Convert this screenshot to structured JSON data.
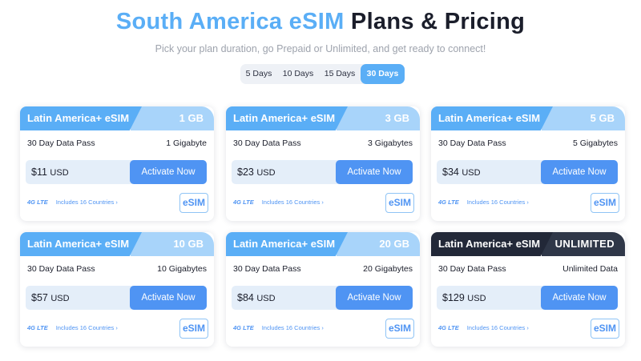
{
  "header": {
    "title_accent": "South America eSIM",
    "title_rest": "Plans & Pricing",
    "subtitle": "Pick your plan duration, go Prepaid or Unlimited, and get ready to connect!"
  },
  "duration_tabs": [
    {
      "label": "5 Days",
      "active": false
    },
    {
      "label": "10 Days",
      "active": false
    },
    {
      "label": "15 Days",
      "active": false
    },
    {
      "label": "30 Days",
      "active": true
    }
  ],
  "plans": [
    {
      "name": "Latin America+ eSIM",
      "size": "1 GB",
      "pass": "30 Day Data Pass",
      "amount": "1 Gigabyte",
      "price": "$11",
      "currency": "USD",
      "cta": "Activate Now",
      "network": "4G LTE",
      "countries": "Includes 16 Countries ›",
      "badge": "eSIM"
    },
    {
      "name": "Latin America+ eSIM",
      "size": "3 GB",
      "pass": "30 Day Data Pass",
      "amount": "3 Gigabytes",
      "price": "$23",
      "currency": "USD",
      "cta": "Activate Now",
      "network": "4G LTE",
      "countries": "Includes 16 Countries ›",
      "badge": "eSIM"
    },
    {
      "name": "Latin America+ eSIM",
      "size": "5 GB",
      "pass": "30 Day Data Pass",
      "amount": "5 Gigabytes",
      "price": "$34",
      "currency": "USD",
      "cta": "Activate Now",
      "network": "4G LTE",
      "countries": "Includes 16 Countries ›",
      "badge": "eSIM"
    },
    {
      "name": "Latin America+ eSIM",
      "size": "10 GB",
      "pass": "30 Day Data Pass",
      "amount": "10 Gigabytes",
      "price": "$57",
      "currency": "USD",
      "cta": "Activate Now",
      "network": "4G LTE",
      "countries": "Includes 16 Countries ›",
      "badge": "eSIM"
    },
    {
      "name": "Latin America+ eSIM",
      "size": "20 GB",
      "pass": "30 Day Data Pass",
      "amount": "20 Gigabytes",
      "price": "$84",
      "currency": "USD",
      "cta": "Activate Now",
      "network": "4G LTE",
      "countries": "Includes 16 Countries ›",
      "badge": "eSIM"
    },
    {
      "name": "Latin America+ eSIM",
      "size": "UNLIMITED",
      "pass": "30 Day Data Pass",
      "amount": "Unlimited Data",
      "price": "$129",
      "currency": "USD",
      "cta": "Activate Now",
      "network": "4G LTE",
      "countries": "Includes 16 Countries ›",
      "badge": "eSIM"
    }
  ],
  "colors": {
    "accent": "#5aaef6",
    "button": "#4f94f3",
    "dark": "#222838"
  }
}
